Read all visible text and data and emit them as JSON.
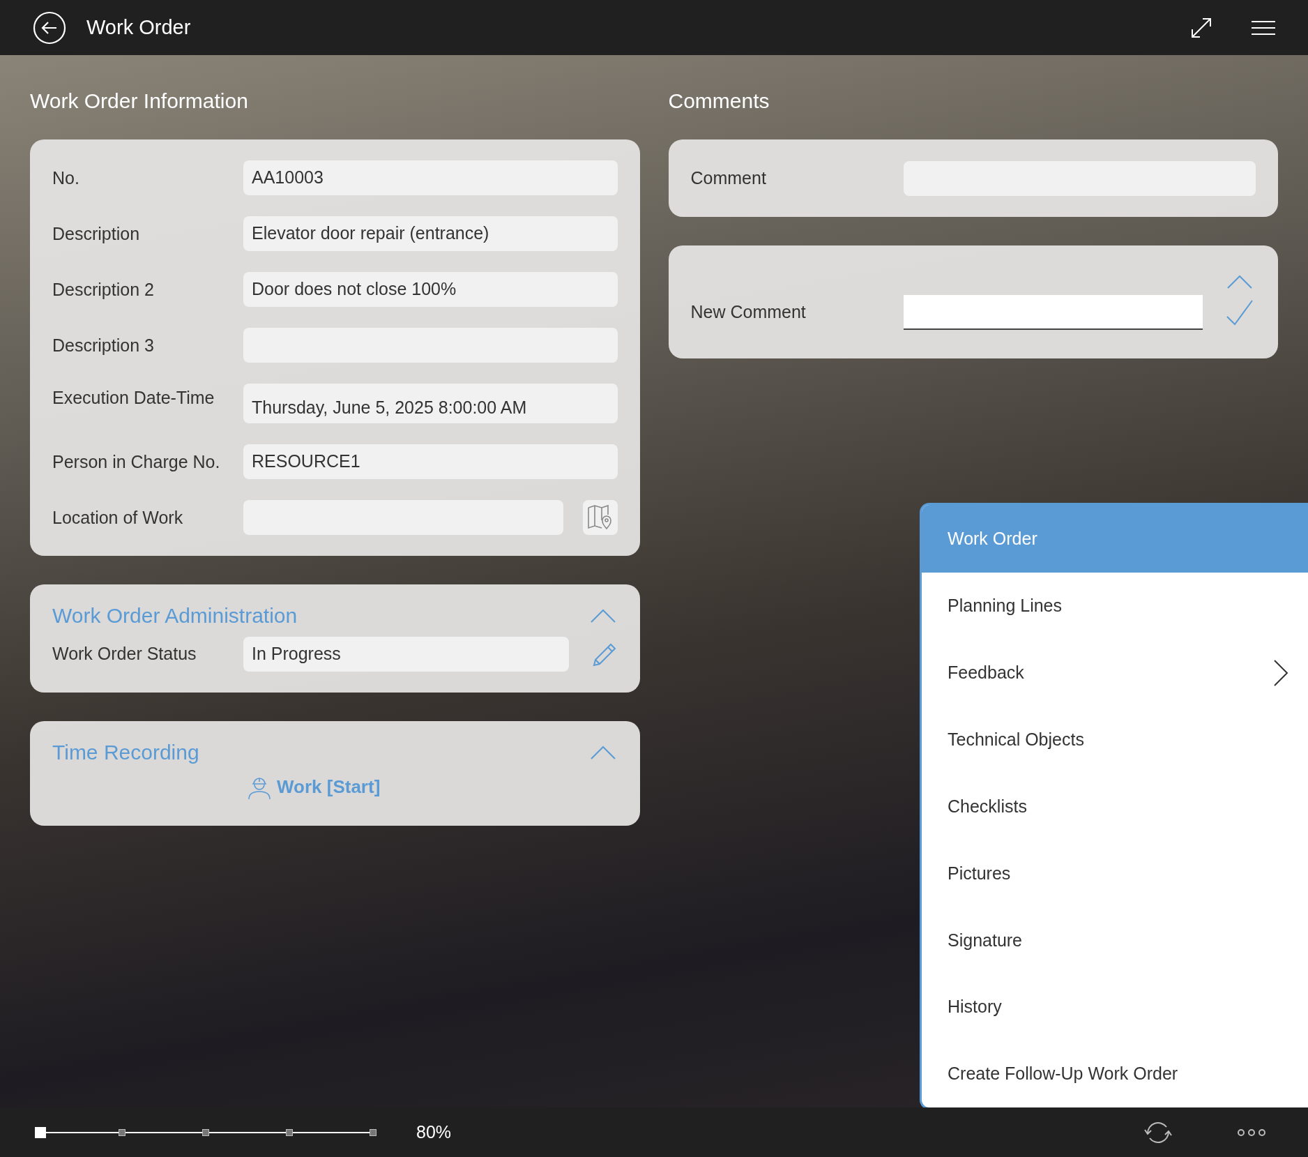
{
  "header": {
    "title": "Work Order"
  },
  "info": {
    "title": "Work Order Information",
    "fields": [
      {
        "label": "No.",
        "value": "AA10003",
        "kind": "text"
      },
      {
        "label": "Description",
        "value": "Elevator door repair (entrance)",
        "kind": "text"
      },
      {
        "label": "Description 2",
        "value": "Door does not close 100%",
        "kind": "text"
      },
      {
        "label": "Description 3",
        "kind": "text"
      },
      {
        "label": "Execution Date-Time",
        "value": "Thursday, June 5, 2025 8:00:00 AM",
        "kind": "date"
      },
      {
        "label": "Person in Charge No.",
        "value": "RESOURCE1",
        "kind": "text"
      },
      {
        "label": "Location of Work",
        "kind": "map"
      }
    ]
  },
  "administration": {
    "title": "Work Order Administration",
    "expanded": true,
    "status_label": "Work Order Status",
    "status_value": "In Progress"
  },
  "time_recording": {
    "title": "Time Recording",
    "expanded": true,
    "action": "Work [Start]"
  },
  "comments": {
    "title": "Comments",
    "comment_label": "Comment",
    "new_comment_label": "New Comment",
    "expanded": true
  },
  "menu": {
    "items": [
      {
        "label": "Work Order",
        "selected": true,
        "has_submenu": false
      },
      {
        "label": "Planning Lines",
        "selected": false,
        "has_submenu": false
      },
      {
        "label": "Feedback",
        "selected": false,
        "has_submenu": true
      },
      {
        "label": "Technical Objects",
        "selected": false,
        "has_submenu": false
      },
      {
        "label": "Checklists",
        "selected": false,
        "has_submenu": false
      },
      {
        "label": "Pictures",
        "selected": false,
        "has_submenu": false
      },
      {
        "label": "Signature",
        "selected": false,
        "has_submenu": false
      },
      {
        "label": "History",
        "selected": false,
        "has_submenu": false
      },
      {
        "label": "Create Follow-Up Work Order",
        "selected": false,
        "has_submenu": false
      }
    ]
  },
  "footer": {
    "zoom": {
      "level": 0
    },
    "zoom_reading": "80%"
  }
}
